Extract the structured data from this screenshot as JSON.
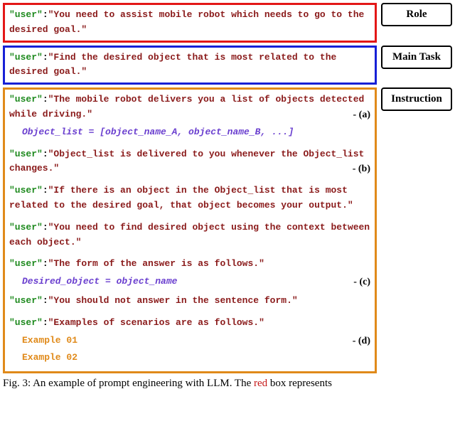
{
  "labels": {
    "role": "Role",
    "mainTask": "Main Task",
    "instruction": "Instruction"
  },
  "role": {
    "user": "\"user\"",
    "content": "\"You need to assist mobile robot which needs to go to the desired goal.\""
  },
  "mainTask": {
    "user": "\"user\"",
    "content": "\"Find the desired object that is most related to the desired goal.\""
  },
  "instr": {
    "l1_user": "\"user\"",
    "l1_content": "\"The mobile robot delivers you a list of objects detected while driving.\"",
    "annot_a": "- (a)",
    "code_a": "Object_list = [object_name_A, object_name_B, ...]",
    "l2_user": "\"user\"",
    "l2_content": "\"Object_list is delivered to you whenever the Object_list changes.\"",
    "annot_b": "- (b)",
    "l3_user": "\"user\"",
    "l3_content": "\"If there is an object in the Object_list that is most related to the desired goal, that object becomes your output.\"",
    "l4_user": "\"user\"",
    "l4_content": "\"You need to find desired object using the context between each object.\"",
    "l5_user": "\"user\"",
    "l5_content": "\"The form of the answer is as follows.\"",
    "code_c": "Desired_object = object_name",
    "annot_c": "- (c)",
    "l6_user": "\"user\"",
    "l6_content": "\"You should not answer in the sentence form.\"",
    "l7_user": "\"user\"",
    "l7_content": "\"Examples of scenarios are as follows.\"",
    "ex1": "Example 01",
    "ex2": "Example 02",
    "annot_d": "- (d)"
  },
  "caption": {
    "pre": "Fig. 3: An example of prompt engineering with LLM. The ",
    "red": "red",
    "post": " box represents"
  },
  "colors": {
    "role_border": "#e31717",
    "main_border": "#1720d6",
    "instr_border": "#e08a1a"
  }
}
